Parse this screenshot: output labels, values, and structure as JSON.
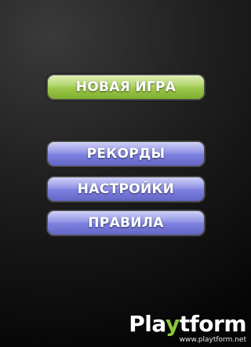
{
  "menu": {
    "new_game": "НОВАЯ ИГРА",
    "records": "РЕКОРДЫ",
    "settings": "НАСТРОЙКИ",
    "rules": "ПРАВИЛА"
  },
  "watermark": {
    "logo_part1": "Pla",
    "logo_part2": "y",
    "logo_part3": "tform",
    "url": "www.playtform.net"
  },
  "colors": {
    "background": "#000000",
    "primary_button": "#9fcb4e",
    "secondary_button": "#7f82e0",
    "button_text": "#ffffff"
  }
}
